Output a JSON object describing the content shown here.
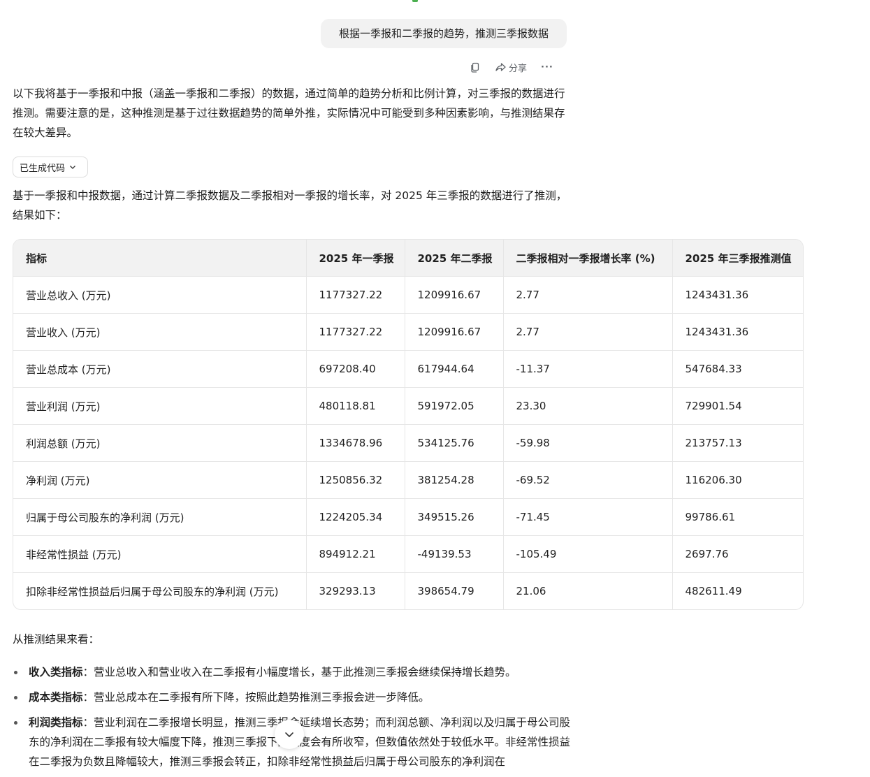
{
  "user_message": "根据一季报和二季报的趋势，推测三季报数据",
  "actions": {
    "share_label": "分享",
    "more_label": "···"
  },
  "intro": "以下我将基于一季报和中报（涵盖一季报和二季报）的数据，通过简单的趋势分析和比例计算，对三季报的数据进行推测。需要注意的是，这种推测是基于过往数据趋势的简单外推，实际情况中可能受到多种因素影响，与推测结果存在较大差异。",
  "code_chip_label": "已生成代码",
  "result_intro": "基于一季报和中报数据，通过计算二季报数据及二季报相对一季报的增长率，对 2025 年三季报的数据进行了推测，结果如下：",
  "table": {
    "headers": [
      "指标",
      "2025 年一季报",
      "2025 年二季报",
      "二季报相对一季报增长率 (%)",
      "2025 年三季报推测值"
    ],
    "rows": [
      [
        "营业总收入 (万元)",
        "1177327.22",
        "1209916.67",
        "2.77",
        "1243431.36"
      ],
      [
        "营业收入 (万元)",
        "1177327.22",
        "1209916.67",
        "2.77",
        "1243431.36"
      ],
      [
        "营业总成本 (万元)",
        "697208.40",
        "617944.64",
        "-11.37",
        "547684.33"
      ],
      [
        "营业利润 (万元)",
        "480118.81",
        "591972.05",
        "23.30",
        "729901.54"
      ],
      [
        "利润总额 (万元)",
        "1334678.96",
        "534125.76",
        "-59.98",
        "213757.13"
      ],
      [
        "净利润 (万元)",
        "1250856.32",
        "381254.28",
        "-69.52",
        "116206.30"
      ],
      [
        "归属于母公司股东的净利润 (万元)",
        "1224205.34",
        "349515.26",
        "-71.45",
        "99786.61"
      ],
      [
        "非经常性损益 (万元)",
        "894912.21",
        "-49139.53",
        "-105.49",
        "2697.76"
      ],
      [
        "扣除非经常性损益后归属于母公司股东的净利润 (万元)",
        "329293.13",
        "398654.79",
        "21.06",
        "482611.49"
      ]
    ]
  },
  "summary_lead": "从推测结果来看：",
  "bullets": [
    {
      "title": "收入类指标",
      "text": "：营业总收入和营业收入在二季报有小幅度增长，基于此推测三季报会继续保持增长趋势。"
    },
    {
      "title": "成本类指标",
      "text": "：营业总成本在二季报有所下降，按照此趋势推测三季报会进一步降低。"
    },
    {
      "title": "利润类指标",
      "text": "：营业利润在二季报增长明显，推测三季报会延续增长态势；而利润总额、净利润以及归属于母公司股东的净利润在二季报有较大幅度下降，推测三季报下降幅度会有所收窄，但数值依然处于较低水平。非经常性损益在二季报为负数且降幅较大，推测三季报会转正，扣除非经常性损益后归属于母公司股东的净利润在"
    }
  ]
}
